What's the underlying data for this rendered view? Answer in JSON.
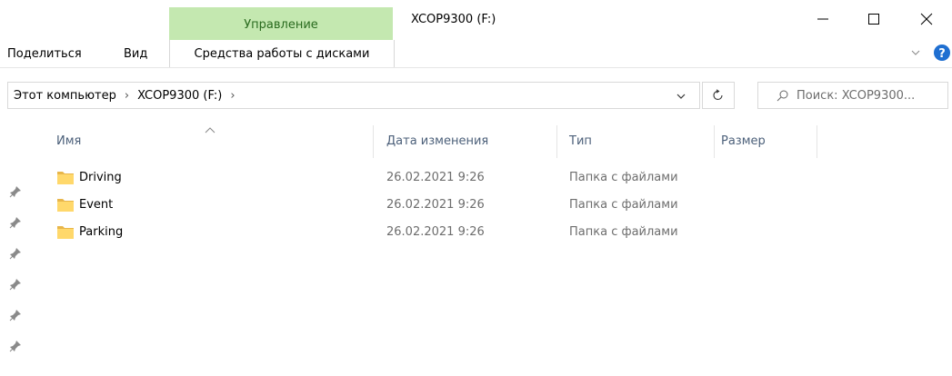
{
  "titlebar": {
    "manage_tab": "Управление",
    "window_title": "XCOP9300 (F:)"
  },
  "ribbon": {
    "tabs": [
      "Поделиться",
      "Вид"
    ],
    "disk_tools_tab": "Средства работы с дисками"
  },
  "address": {
    "crumb_root": "Этот компьютер",
    "crumb_drive": "XCOP9300 (F:)",
    "separator": "›"
  },
  "search": {
    "placeholder": "Поиск: XCOP9300..."
  },
  "columns": {
    "name": "Имя",
    "date": "Дата изменения",
    "type": "Тип",
    "size": "Размер"
  },
  "files": [
    {
      "name": "Driving",
      "date": "26.02.2021 9:26",
      "type": "Папка с файлами"
    },
    {
      "name": "Event",
      "date": "26.02.2021 9:26",
      "type": "Папка с файлами"
    },
    {
      "name": "Parking",
      "date": "26.02.2021 9:26",
      "type": "Папка с файлами"
    }
  ],
  "colors": {
    "manage_tab_bg": "#c4e8b0",
    "header_text": "#4c607a",
    "help_icon": "#1f6fd1"
  }
}
